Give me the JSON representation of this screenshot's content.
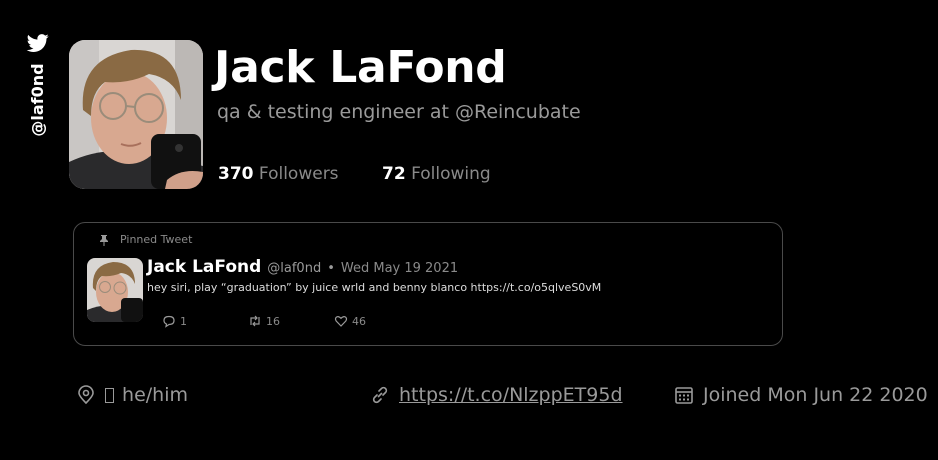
{
  "sidebar": {
    "icon": "twitter-bird-icon",
    "handle": "@laf0nd"
  },
  "profile": {
    "name": "Jack LaFond",
    "bio": "qa & testing engineer at @Reincubate",
    "followers_count": "370",
    "followers_label": "Followers",
    "following_count": "72",
    "following_label": "Following"
  },
  "pinned_tweet": {
    "label": "Pinned Tweet",
    "author_name": "Jack LaFond",
    "author_handle": "@laf0nd",
    "separator": "•",
    "date": "Wed May 19 2021",
    "text": "hey siri, play “graduation” by juice wrld and benny blanco https://t.co/o5qlveS0vM",
    "replies": "1",
    "retweets": "16",
    "likes": "46"
  },
  "meta": {
    "location": "he/him",
    "link": "https://t.co/NlzppET95d",
    "joined": "Joined Mon Jun 22 2020"
  },
  "colors": {
    "background": "#000000",
    "text": "#ffffff",
    "muted": "#9a9a9a",
    "card_border": "#4a4a4a"
  }
}
